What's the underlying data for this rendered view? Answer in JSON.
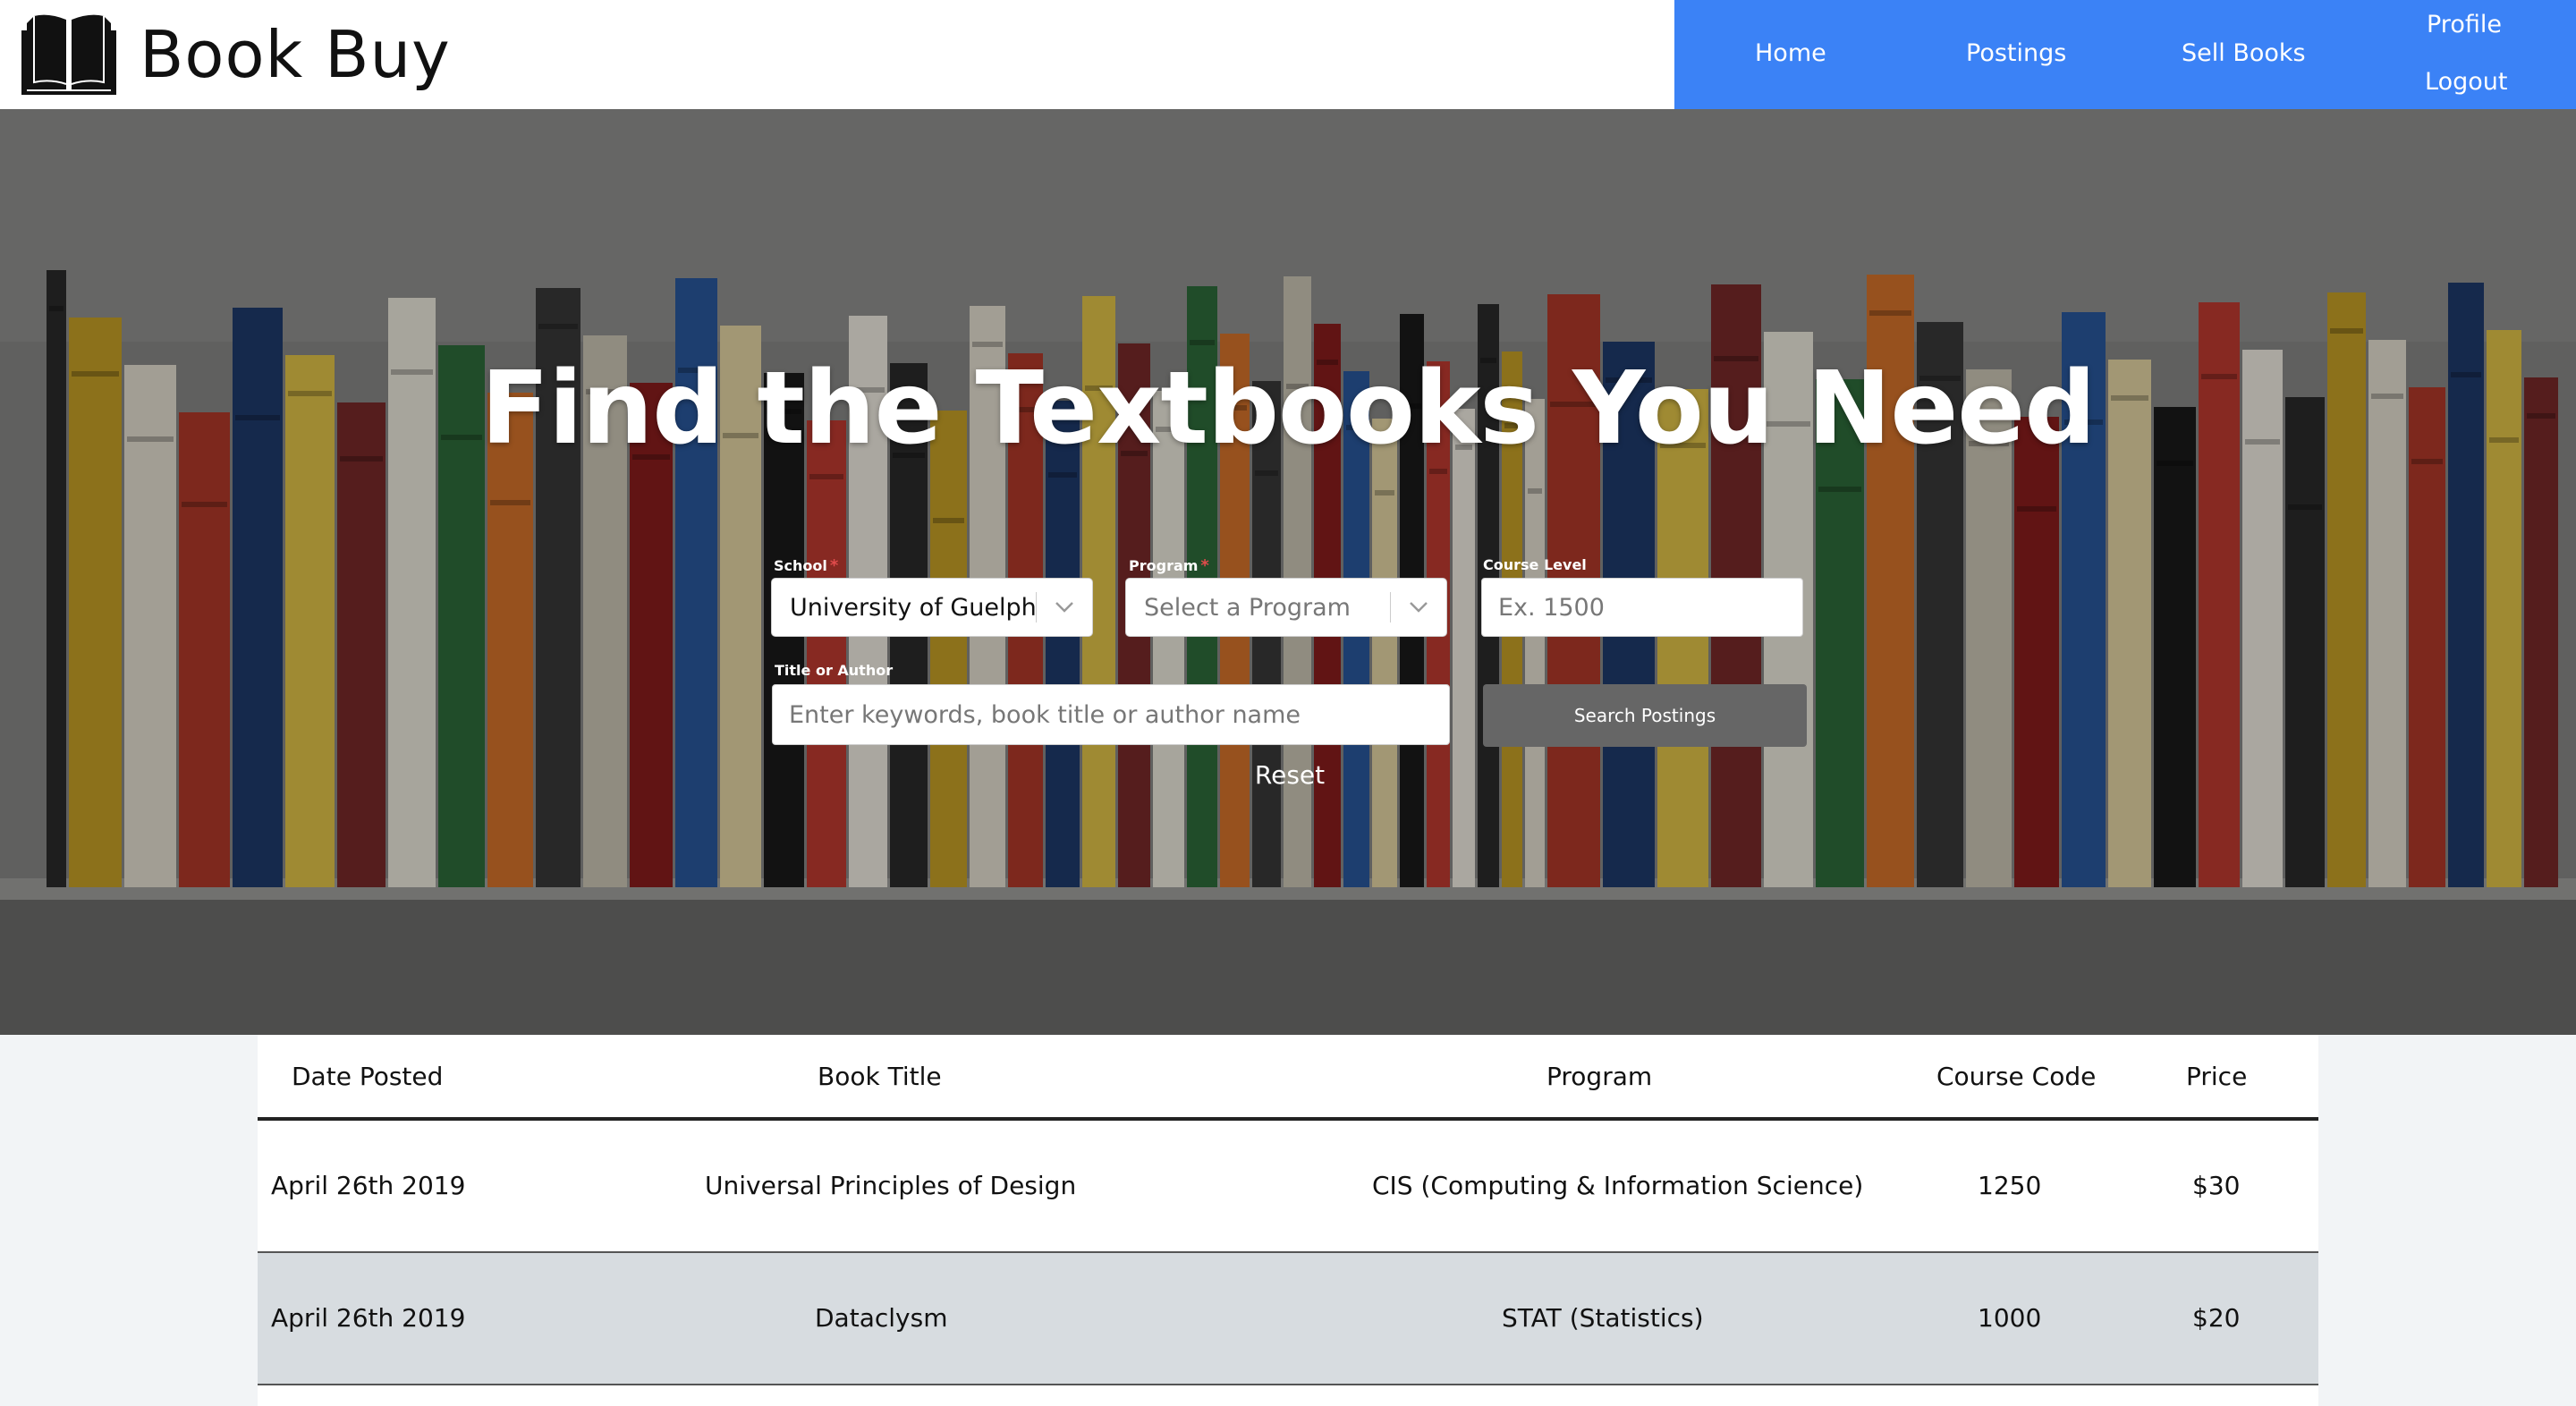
{
  "header": {
    "brand_name": "Book Buy",
    "logo_icon": "open-book-icon",
    "nav": {
      "home": "Home",
      "postings": "Postings",
      "sell_books": "Sell Books",
      "profile": "Profile",
      "logout": "Logout"
    },
    "nav_color": "#3b82f6"
  },
  "hero": {
    "title": "Find the Textbooks You Need",
    "school": {
      "label": "School",
      "value": "University of Guelph",
      "required": true
    },
    "program": {
      "label": "Program",
      "placeholder": "Select a Program",
      "required": true
    },
    "course_level": {
      "label": "Course Level",
      "placeholder": "Ex. 1500"
    },
    "title_author": {
      "label": "Title or Author",
      "placeholder": "Enter keywords, book title or author name"
    },
    "search_button": "Search Postings",
    "reset": "Reset"
  },
  "table": {
    "headers": [
      "Date Posted",
      "Book Title",
      "Program",
      "Course Code",
      "Price"
    ],
    "rows": [
      [
        "April 26th 2019",
        "Universal Principles of Design",
        "CIS (Computing & Information Science)",
        "1250",
        "$30"
      ],
      [
        "April 26th 2019",
        "Dataclysm",
        "STAT (Statistics)",
        "1000",
        "$20"
      ]
    ]
  }
}
